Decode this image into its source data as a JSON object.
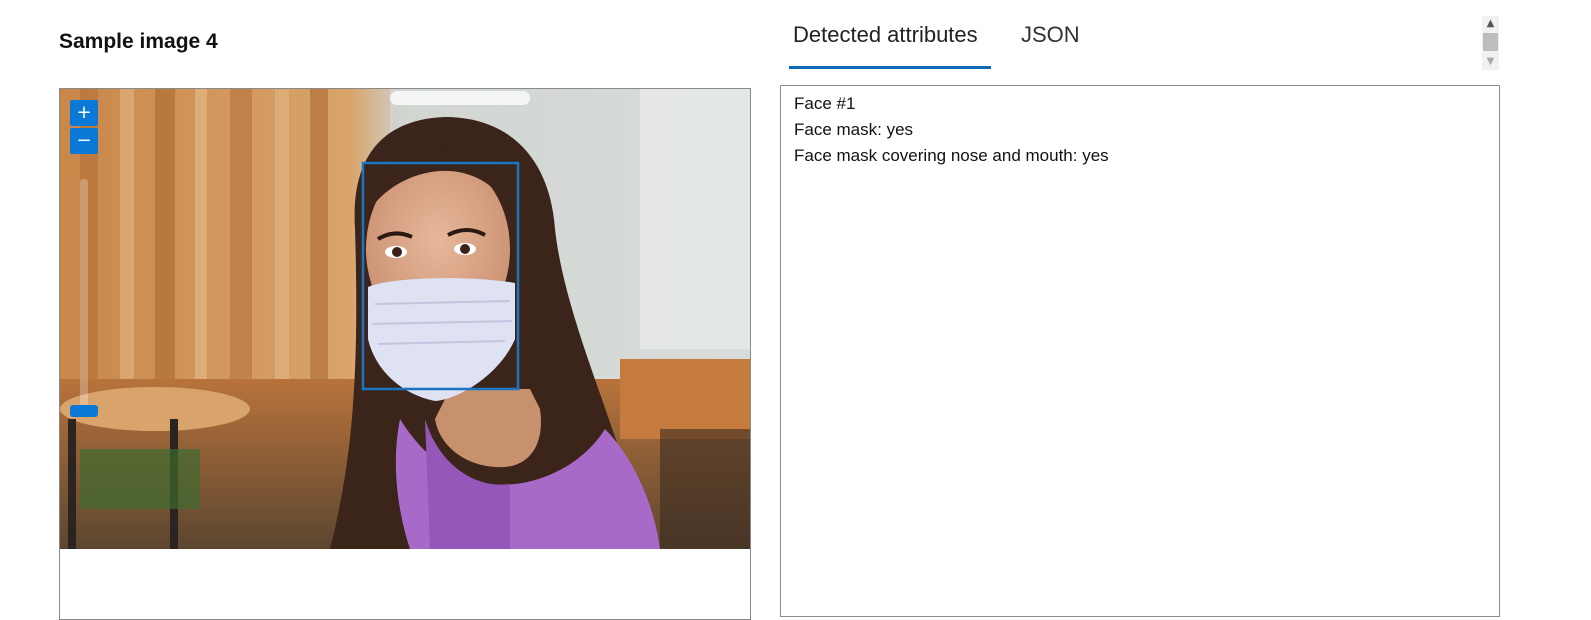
{
  "sample": {
    "title": "Sample image 4"
  },
  "viewer": {
    "zoom_in_label": "+",
    "zoom_out_label": "−"
  },
  "tabs": [
    {
      "label": "Detected attributes",
      "active": true
    },
    {
      "label": "JSON",
      "active": false
    }
  ],
  "results": {
    "lines": [
      "Face #1",
      "Face mask: yes",
      "Face mask covering nose and mouth: yes"
    ]
  },
  "colors": {
    "accent": "#0a78d7",
    "tab_underline": "#0b6bb8",
    "face_box": "#1a74c4"
  },
  "icons": {
    "zoom_in": "plus-icon",
    "zoom_out": "minus-icon",
    "scroll_up": "chevron-up-icon",
    "scroll_down": "chevron-down-icon"
  }
}
